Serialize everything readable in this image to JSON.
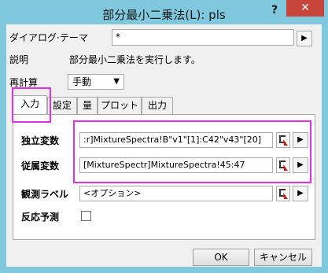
{
  "window": {
    "title": "部分最小二乗法(L): pls",
    "help": "?",
    "close": "✕"
  },
  "theme": {
    "label": "ダイアログ·テーマ",
    "value": "*"
  },
  "description": {
    "label": "説明",
    "value": "部分最小二乗法を実行します。"
  },
  "recalc": {
    "label": "再計算",
    "value": "手動"
  },
  "tabs": [
    {
      "label": "入力"
    },
    {
      "label": "設定"
    },
    {
      "label": "量"
    },
    {
      "label": "プロット"
    },
    {
      "label": "出力"
    }
  ],
  "input": {
    "independent": {
      "label": "独立変数",
      "value": ":r]MixtureSpectra!B\"v1\"[1]:C42\"v43\"[20]"
    },
    "dependent": {
      "label": "従属変数",
      "value": "[MixtureSpectr]MixtureSpectra!45:47"
    },
    "observation": {
      "label": "観測ラベル",
      "value": "<オプション>"
    },
    "predict": {
      "label": "反応予測"
    }
  },
  "buttons": {
    "ok": "OK",
    "cancel": "キャンセル"
  },
  "icons": {
    "arrow": "▶",
    "dropdown": "▼"
  },
  "colors": {
    "highlight": "#e52ee5",
    "close": "#c7453a",
    "frame": "#7fc8dd"
  }
}
